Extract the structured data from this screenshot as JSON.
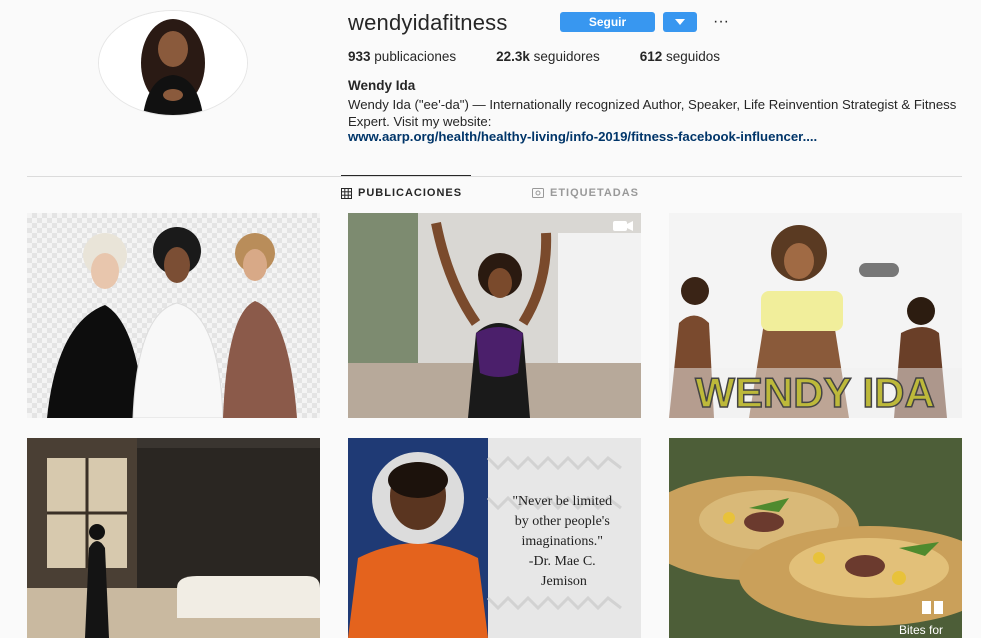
{
  "profile": {
    "username": "wendyidafitness",
    "follow_label": "Seguir",
    "more_label": "···",
    "stats": {
      "posts": "933",
      "posts_label": "publicaciones",
      "followers": "22.3k",
      "followers_label": "seguidores",
      "following": "612",
      "following_label": "seguidos"
    },
    "full_name": "Wendy Ida",
    "bio": "Wendy Ida (\"ee'-da\") — Internationally recognized Author, Speaker, Life Reinvention Strategist & Fitness Expert. Visit my website:",
    "website": "www.aarp.org/health/healthy-living/info-2019/fitness-facebook-influencer...."
  },
  "tabs": [
    {
      "label": "PUBLICACIONES",
      "icon": "grid-icon",
      "active": true
    },
    {
      "label": "ETIQUETADAS",
      "icon": "tag-icon",
      "active": false
    }
  ],
  "posts": [
    {
      "kind": "photo",
      "name": "red-carpet-women"
    },
    {
      "kind": "video",
      "name": "dancing-woman-video"
    },
    {
      "kind": "photo",
      "name": "fitness-banner",
      "overlay_text": "WENDY IDA"
    },
    {
      "kind": "photo",
      "name": "bathroom-silhouette"
    },
    {
      "kind": "photo",
      "name": "astronaut-quote",
      "quote_lines": [
        "\"Never be limited",
        "by other people's",
        "imaginations.\"",
        "-Dr. Mae C.",
        "Jemison"
      ]
    },
    {
      "kind": "photo",
      "name": "burrito-food",
      "overlay_text": "Bites for"
    }
  ],
  "colors": {
    "accent": "#3897f0",
    "link": "#003569",
    "background": "#fafafa"
  }
}
